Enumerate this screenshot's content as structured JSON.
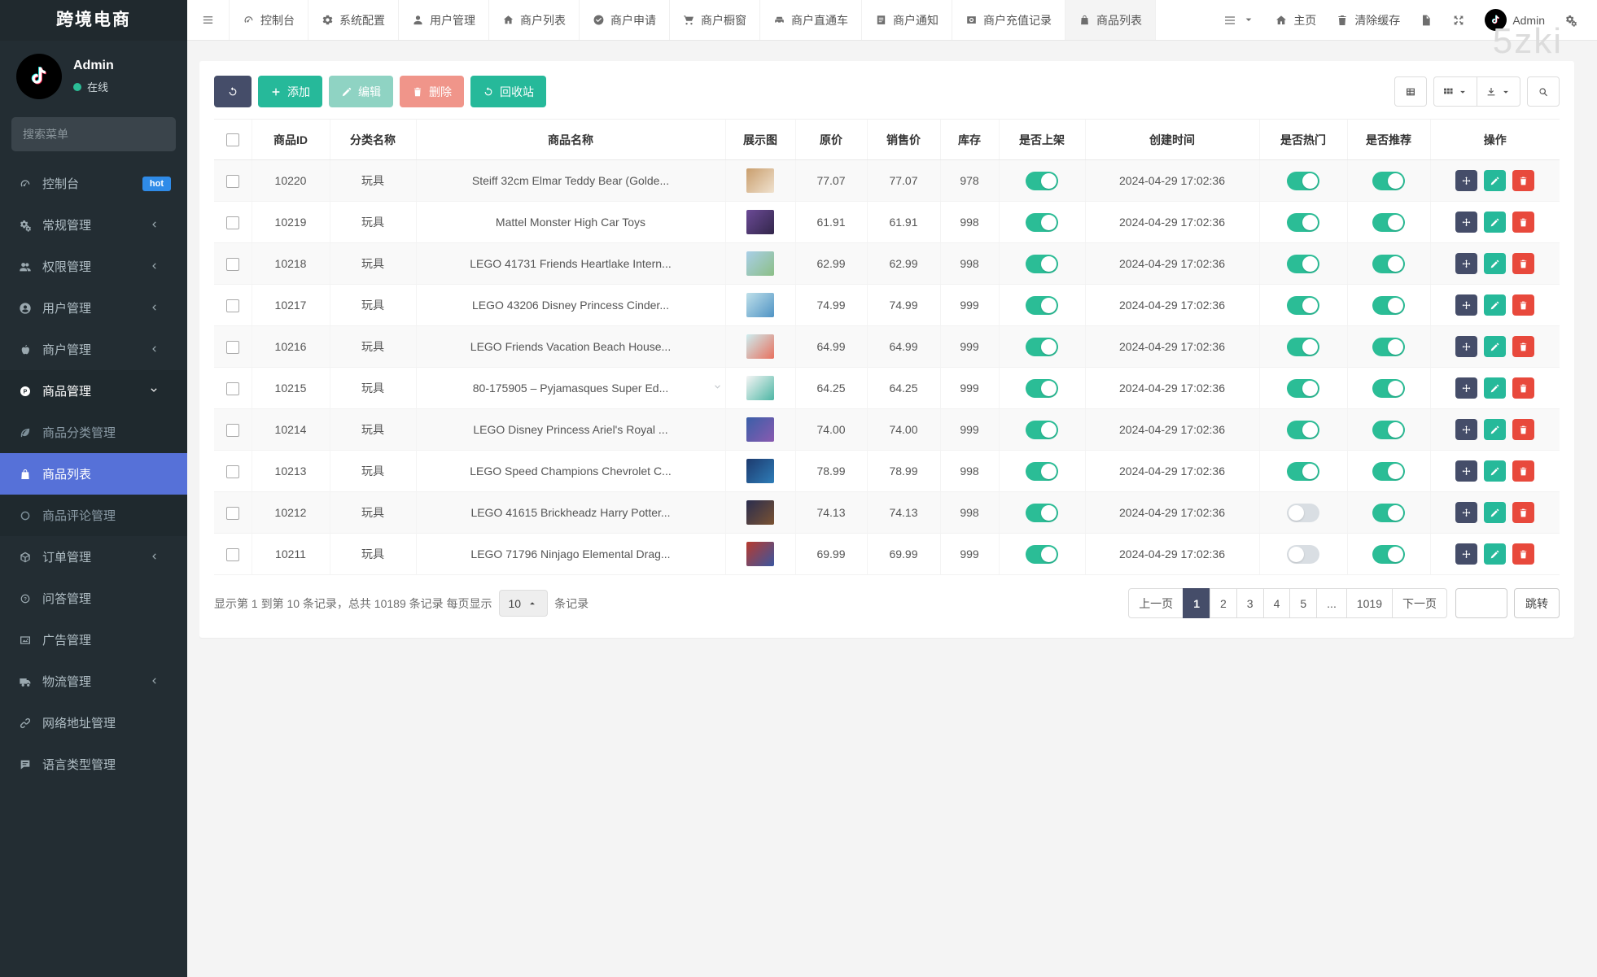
{
  "app": {
    "brand": "跨境电商",
    "watermark": "5zki"
  },
  "colors": {
    "accent_teal": "#26b99a",
    "toggle_on": "#2bbd96",
    "dark_navy": "#454d69",
    "active_menu_blue": "#5671d8",
    "danger_red": "#e8493c",
    "hot_badge_blue": "#2f8be8"
  },
  "sidebar": {
    "user": {
      "name": "Admin",
      "status": "在线"
    },
    "search_placeholder": "搜索菜单",
    "menu": [
      {
        "key": "dashboard",
        "label": "控制台",
        "icon": "gauge",
        "badge": "hot"
      },
      {
        "key": "general",
        "label": "常规管理",
        "icon": "cogs",
        "chevron": "left"
      },
      {
        "key": "auth",
        "label": "权限管理",
        "icon": "users",
        "chevron": "left"
      },
      {
        "key": "user-management",
        "label": "用户管理",
        "icon": "usercircle",
        "chevron": "left"
      },
      {
        "key": "merchant-management",
        "label": "商户管理",
        "icon": "apple",
        "chevron": "left"
      },
      {
        "key": "product-management",
        "label": "商品管理",
        "icon": "product",
        "chevron": "down",
        "expanded": true,
        "children": [
          {
            "key": "product-category",
            "label": "商品分类管理",
            "icon": "leaf"
          },
          {
            "key": "product-list",
            "label": "商品列表",
            "icon": "bag",
            "active": true
          },
          {
            "key": "product-comment",
            "label": "商品评论管理",
            "icon": "circleo"
          }
        ]
      },
      {
        "key": "order",
        "label": "订单管理",
        "icon": "cube",
        "chevron": "left"
      },
      {
        "key": "qa",
        "label": "问答管理",
        "icon": "question"
      },
      {
        "key": "ad",
        "label": "广告管理",
        "icon": "image"
      },
      {
        "key": "logistics",
        "label": "物流管理",
        "icon": "truck",
        "chevron": "left"
      },
      {
        "key": "url-management",
        "label": "网络地址管理",
        "icon": "link"
      },
      {
        "key": "language-type",
        "label": "语言类型管理",
        "icon": "bubble"
      }
    ]
  },
  "navbar": {
    "tabs": [
      {
        "key": "dashboard",
        "label": "控制台",
        "icon": "gauge"
      },
      {
        "key": "system-config",
        "label": "系统配置",
        "icon": "gear"
      },
      {
        "key": "user-management",
        "label": "用户管理",
        "icon": "user"
      },
      {
        "key": "merchant-list",
        "label": "商户列表",
        "icon": "home"
      },
      {
        "key": "merchant-apply",
        "label": "商户申请",
        "icon": "checkcircle"
      },
      {
        "key": "merchant-window",
        "label": "商户橱窗",
        "icon": "cart"
      },
      {
        "key": "merchant-train",
        "label": "商户直通车",
        "icon": "car"
      },
      {
        "key": "merchant-notice",
        "label": "商户通知",
        "icon": "memo"
      },
      {
        "key": "merchant-recharge",
        "label": "商户充值记录",
        "icon": "record"
      },
      {
        "key": "product-list",
        "label": "商品列表",
        "icon": "bag",
        "active": true
      }
    ],
    "right": {
      "home": "主页",
      "clear_cache": "清除缓存",
      "user": "Admin"
    }
  },
  "toolbar": {
    "refresh": "",
    "add": "添加",
    "edit": "编辑",
    "delete": "删除",
    "recycle": "回收站"
  },
  "table": {
    "columns": [
      "",
      "商品ID",
      "分类名称",
      "商品名称",
      "展示图",
      "原价",
      "销售价",
      "库存",
      "是否上架",
      "创建时间",
      "是否热门",
      "是否推荐",
      "操作"
    ],
    "rows": [
      {
        "id": "10220",
        "cat": "玩具",
        "name": "Steiff 32cm Elmar Teddy Bear (Golde...",
        "thumb": [
          "#c99e6d",
          "#f0e2cf"
        ],
        "price": "77.07",
        "sale": "77.07",
        "stock": "978",
        "on": true,
        "created": "2024-04-29 17:02:36",
        "hot": true,
        "rec": true
      },
      {
        "id": "10219",
        "cat": "玩具",
        "name": "Mattel Monster High Car Toys",
        "thumb": [
          "#6b4a96",
          "#32264a"
        ],
        "price": "61.91",
        "sale": "61.91",
        "stock": "998",
        "on": true,
        "created": "2024-04-29 17:02:36",
        "hot": true,
        "rec": true
      },
      {
        "id": "10218",
        "cat": "玩具",
        "name": "LEGO 41731 Friends Heartlake Intern...",
        "thumb": [
          "#a9cfe8",
          "#8cbf86"
        ],
        "price": "62.99",
        "sale": "62.99",
        "stock": "998",
        "on": true,
        "created": "2024-04-29 17:02:36",
        "hot": true,
        "rec": true
      },
      {
        "id": "10217",
        "cat": "玩具",
        "name": "LEGO 43206 Disney Princess Cinder...",
        "thumb": [
          "#bfe0ea",
          "#4f93c4"
        ],
        "price": "74.99",
        "sale": "74.99",
        "stock": "999",
        "on": true,
        "created": "2024-04-29 17:02:36",
        "hot": true,
        "rec": true
      },
      {
        "id": "10216",
        "cat": "玩具",
        "name": "LEGO Friends Vacation Beach House...",
        "thumb": [
          "#cdeef0",
          "#e8705e"
        ],
        "price": "64.99",
        "sale": "64.99",
        "stock": "999",
        "on": true,
        "created": "2024-04-29 17:02:36",
        "hot": true,
        "rec": true
      },
      {
        "id": "10215",
        "cat": "玩具",
        "name": "80-175905 – Pyjamasques Super Ed...",
        "thumb": [
          "#f5f5f5",
          "#4db6a4"
        ],
        "price": "64.25",
        "sale": "64.25",
        "stock": "999",
        "on": true,
        "created": "2024-04-29 17:02:36",
        "hot": true,
        "rec": true,
        "chevron": true
      },
      {
        "id": "10214",
        "cat": "玩具",
        "name": "LEGO Disney Princess Ariel's Royal ...",
        "thumb": [
          "#3a5fa8",
          "#8a5ab0"
        ],
        "price": "74.00",
        "sale": "74.00",
        "stock": "999",
        "on": true,
        "created": "2024-04-29 17:02:36",
        "hot": true,
        "rec": true
      },
      {
        "id": "10213",
        "cat": "玩具",
        "name": "LEGO Speed Champions Chevrolet C...",
        "thumb": [
          "#1d3a6e",
          "#2e7db8"
        ],
        "price": "78.99",
        "sale": "78.99",
        "stock": "998",
        "on": true,
        "created": "2024-04-29 17:02:36",
        "hot": true,
        "rec": true
      },
      {
        "id": "10212",
        "cat": "玩具",
        "name": "LEGO 41615 Brickheadz Harry Potter...",
        "thumb": [
          "#2a2d4e",
          "#7a5232"
        ],
        "price": "74.13",
        "sale": "74.13",
        "stock": "998",
        "on": true,
        "created": "2024-04-29 17:02:36",
        "hot": false,
        "rec": true
      },
      {
        "id": "10211",
        "cat": "玩具",
        "name": "LEGO 71796 Ninjago Elemental Drag...",
        "thumb": [
          "#b83a2e",
          "#3a56a0"
        ],
        "price": "69.99",
        "sale": "69.99",
        "stock": "999",
        "on": true,
        "created": "2024-04-29 17:02:36",
        "hot": false,
        "rec": true
      }
    ]
  },
  "footer": {
    "summary_prefix": "显示第 1 到第 10 条记录，总共 10189 条记录 每页显示",
    "page_size": "10",
    "summary_suffix": "条记录",
    "pages": [
      "上一页",
      "1",
      "2",
      "3",
      "4",
      "5",
      "...",
      "1019",
      "下一页"
    ],
    "active_page": "1",
    "jump_label": "跳转"
  }
}
